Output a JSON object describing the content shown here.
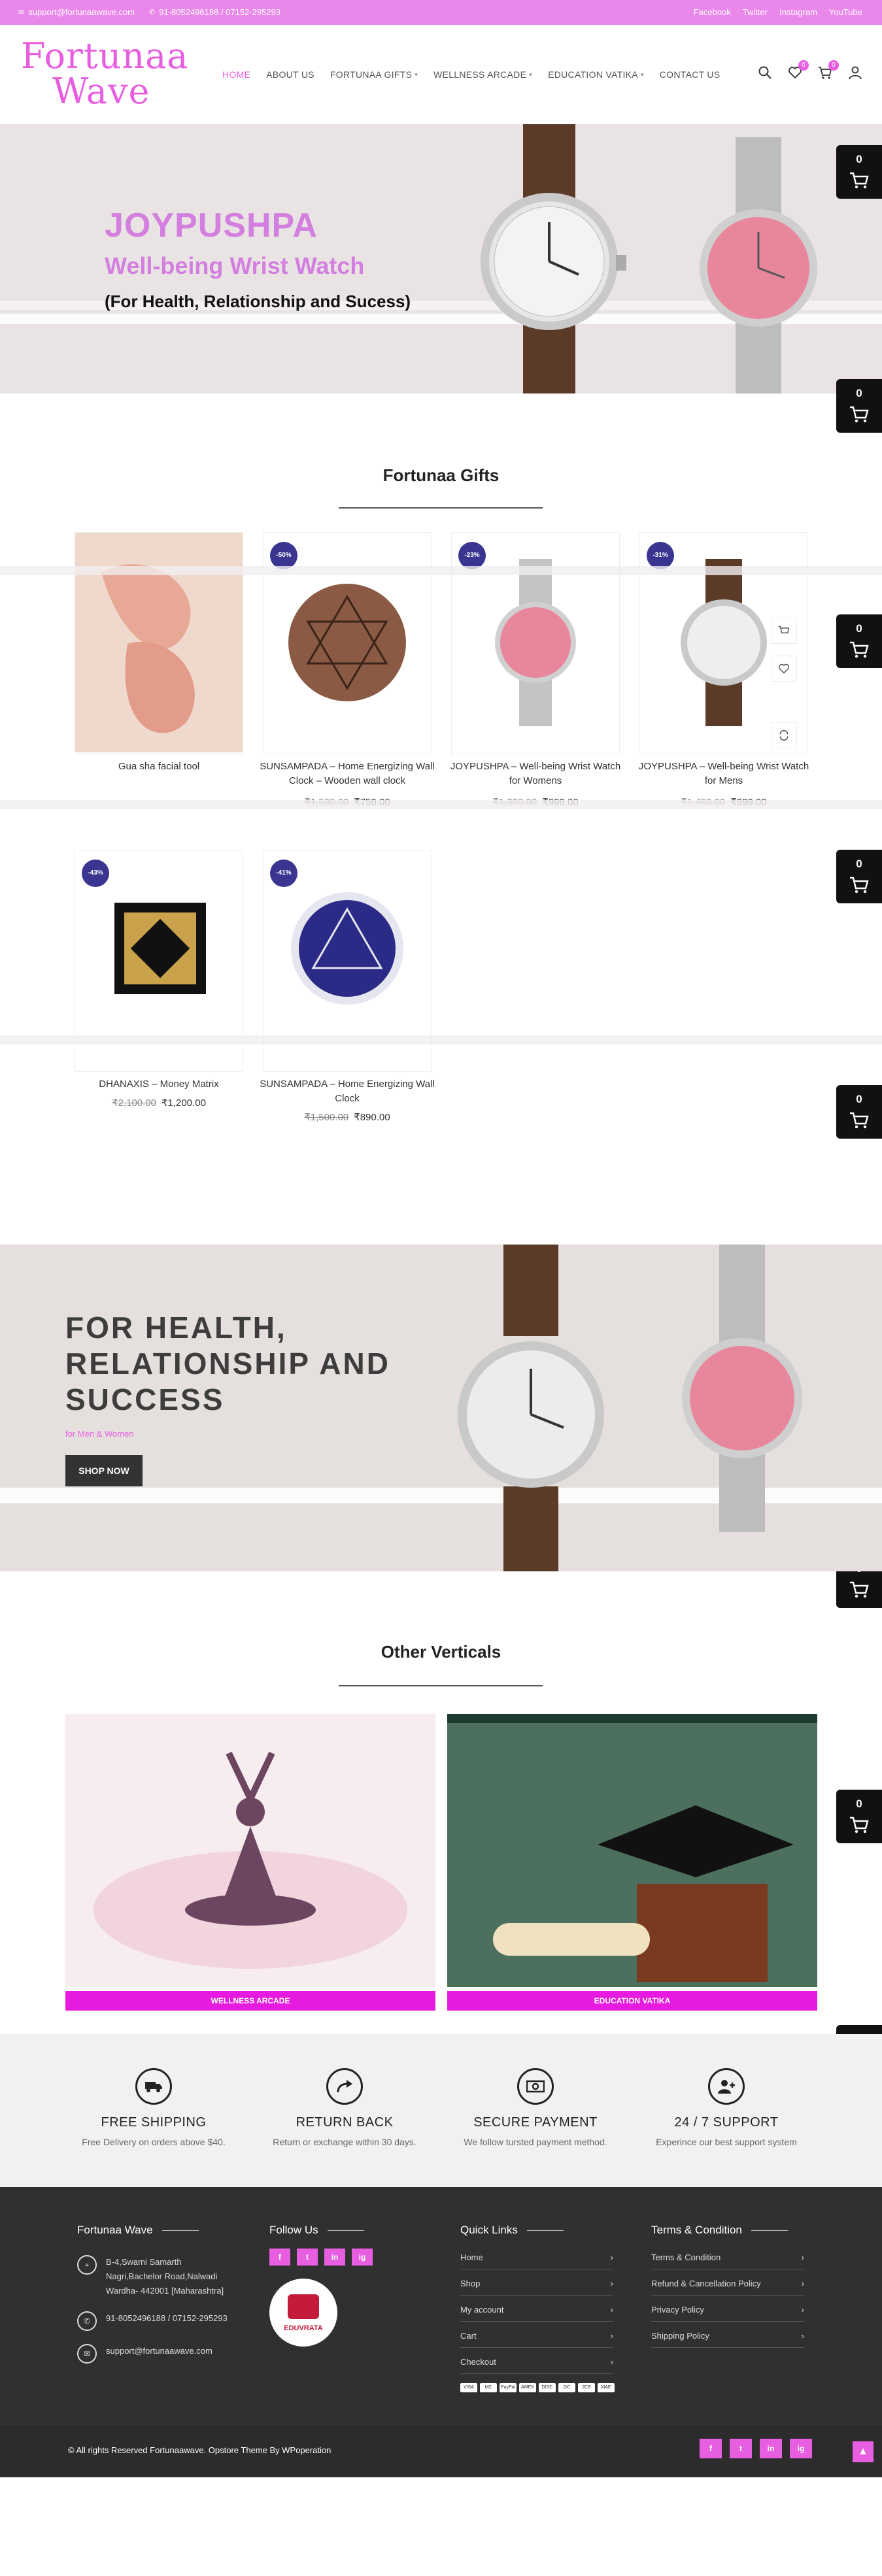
{
  "topbar": {
    "email": "support@fortunaawave.com",
    "phone": "91-8052496188 / 07152-295293",
    "social": [
      "Facebook",
      "Twitter",
      "Instagram",
      "YouTube"
    ]
  },
  "header": {
    "logo_line1": "Fortunaa",
    "logo_line2": "Wave",
    "nav": [
      {
        "label": "HOME",
        "active": true,
        "has_dropdown": false
      },
      {
        "label": "ABOUT US",
        "active": false,
        "has_dropdown": false
      },
      {
        "label": "FORTUNAA GIFTS",
        "active": false,
        "has_dropdown": true
      },
      {
        "label": "WELLNESS ARCADE",
        "active": false,
        "has_dropdown": true
      },
      {
        "label": "EDUCATION VATIKA",
        "active": false,
        "has_dropdown": true
      },
      {
        "label": "CONTACT US",
        "active": false,
        "has_dropdown": false
      }
    ],
    "wishlist_count": "0",
    "cart_count": "0"
  },
  "hero": {
    "title": "JOYPUSHPA",
    "subtitle": "Well-being Wrist Watch",
    "tagline": "(For Health, Relationship and Sucess)"
  },
  "floating_cart": {
    "count": "0"
  },
  "gifts": {
    "title": "Fortunaa Gifts",
    "products": [
      {
        "name": "Gua sha facial tool",
        "old_price": "",
        "price": "",
        "discount": ""
      },
      {
        "name": "SUNSAMPADA – Home Energizing Wall Clock – Wooden wall clock",
        "old_price": "₹1,500.00",
        "price": "₹750.00",
        "discount": "-50%"
      },
      {
        "name": "JOYPUSHPA – Well-being Wrist Watch for Womens",
        "old_price": "₹1,300.00",
        "price": "₹999.00",
        "discount": "-23%"
      },
      {
        "name": "JOYPUSHPA – Well-being Wrist Watch for Mens",
        "old_price": "₹1,450.00",
        "price": "₹999.00",
        "discount": "-31%"
      },
      {
        "name": "DHANAXIS – Money Matrix",
        "old_price": "₹2,100.00",
        "price": "₹1,200.00",
        "discount": "-43%"
      },
      {
        "name": "SUNSAMPADA – Home Energizing Wall Clock",
        "old_price": "₹1,500.00",
        "price": "₹890.00",
        "discount": "-41%"
      }
    ]
  },
  "banner2": {
    "title_l1": "FOR HEALTH,",
    "title_l2": "RELATIONSHIP AND",
    "title_l3": "SUCCESS",
    "subtitle": "for Men & Women",
    "button": "SHOP NOW"
  },
  "verticals": {
    "title": "Other Verticals",
    "items": [
      {
        "label": "WELLNESS ARCADE"
      },
      {
        "label": "EDUCATION VATIKA"
      }
    ]
  },
  "features": [
    {
      "title": "FREE SHIPPING",
      "desc": "Free Delivery on orders above $40.",
      "icon": "truck-icon"
    },
    {
      "title": "RETURN BACK",
      "desc": "Return or exchange within 30 days.",
      "icon": "return-arrow-icon"
    },
    {
      "title": "SECURE PAYMENT",
      "desc": "We follow tursted payment method.",
      "icon": "money-icon"
    },
    {
      "title": "24 / 7 SUPPORT",
      "desc": "Experince our best support system",
      "icon": "user-plus-icon"
    }
  ],
  "footer": {
    "col1": {
      "title": "Fortunaa Wave",
      "address": "B-4,Swami Samarth Nagri,Bachelor Road,Nalwadi Wardha- 442001 [Maharashtra]",
      "phone": "91-8052496188 / 07152-295293",
      "email": "support@fortunaawave.com"
    },
    "col2": {
      "title": "Follow Us",
      "social": [
        "f",
        "t",
        "in",
        "ig"
      ],
      "badge_text": "EDUVRATA"
    },
    "col3": {
      "title": "Quick Links",
      "links": [
        "Home",
        "Shop",
        "My account",
        "Cart",
        "Checkout"
      ]
    },
    "col4": {
      "title": "Terms & Condition",
      "links": [
        "Terms & Condition",
        "Refund & Cancellation Policy",
        "Privacy Policy",
        "Shipping Policy"
      ]
    },
    "payment_icons": [
      "VISA",
      "MC",
      "PayPal",
      "AMEX",
      "DISC",
      "DC",
      "JCB",
      "MAE"
    ],
    "copyright": "© All rights Reserved Fortunaawave. Opstore Theme By WPoperation",
    "bottom_social": [
      "f",
      "t",
      "in",
      "ig"
    ]
  },
  "colors": {
    "accent": "#e85ee1",
    "topbar": "#ea87ea",
    "footer": "#303030",
    "badge": "#3a3591",
    "vertical_button": "#e61bdf"
  }
}
